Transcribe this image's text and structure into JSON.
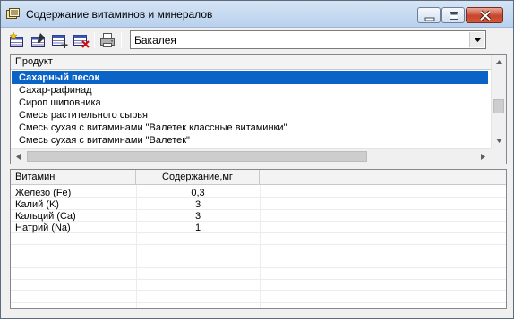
{
  "window": {
    "title": "Содержание витаминов и минералов",
    "icons": [
      "database-icon",
      "minimize-icon",
      "maximize-icon",
      "close-icon"
    ]
  },
  "toolbar": {
    "buttons": [
      {
        "icon": "add-record-icon"
      },
      {
        "icon": "edit-record-icon"
      },
      {
        "icon": "add-row-icon"
      },
      {
        "icon": "delete-record-icon"
      },
      {
        "icon": "print-icon"
      }
    ],
    "category": "Бакалея"
  },
  "products": {
    "header": "Продукт",
    "items": [
      "Сахарный песок",
      "Сахар-рафинад",
      "Сироп шиповника",
      "Смесь растительного сырья",
      "Смесь сухая с витаминами \"Валетек классные витаминки\"",
      "Смесь сухая с витаминами \"Валетек\""
    ],
    "selected_index": 0
  },
  "vitamins": {
    "headers": {
      "vitamin": "Витамин",
      "content": "Содержание,мг"
    },
    "rows": [
      {
        "vitamin": "Железо (Fe)",
        "content": "0,3"
      },
      {
        "vitamin": "Калий (K)",
        "content": "3"
      },
      {
        "vitamin": "Кальций (Ca)",
        "content": "3"
      },
      {
        "vitamin": "Натрий (Na)",
        "content": "1"
      }
    ]
  },
  "colors": {
    "selection": "#0a64c8",
    "close_button": "#c7452b",
    "titlebar": "#c6daf2"
  }
}
